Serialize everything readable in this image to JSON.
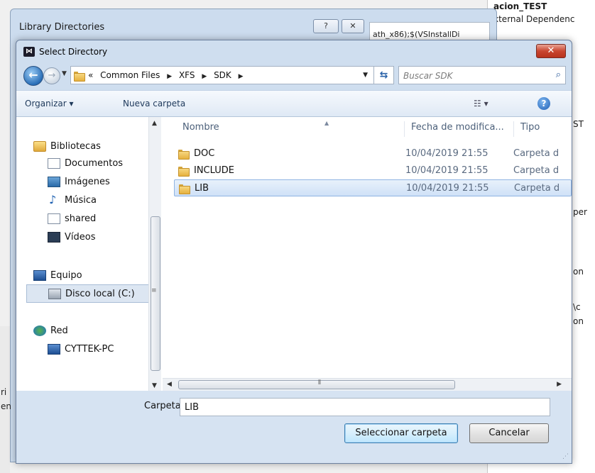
{
  "background": {
    "right_title": "acion_TEST",
    "right_subtitle": "xternal Dependenc",
    "right_fragments": [
      "ST",
      "per",
      "on",
      "\\c",
      "on"
    ],
    "libdir_title": "Library Directories",
    "libdir_help_label": "?",
    "libdir_close_label": "✕",
    "libdir_path_text": "ath_x86);$(VSInstallDi",
    "left_fragments": [
      "ri",
      "en"
    ]
  },
  "dialog": {
    "title": "Select Directory",
    "close_label": "✕"
  },
  "nav": {
    "breadcrumb": [
      "«",
      "Common Files",
      "XFS",
      "SDK"
    ],
    "search_placeholder": "Buscar SDK"
  },
  "toolbar": {
    "organize_label": "Organizar ▾",
    "new_folder_label": "Nueva carpeta",
    "view_label": "☷ ▾",
    "help_label": "?"
  },
  "sidebar": {
    "items": [
      {
        "label": "Bibliotecas",
        "icon": "library-icon"
      },
      {
        "label": "Documentos",
        "icon": "documents-icon"
      },
      {
        "label": "Imágenes",
        "icon": "pictures-icon"
      },
      {
        "label": "Música",
        "icon": "music-icon"
      },
      {
        "label": "shared",
        "icon": "shared-icon"
      },
      {
        "label": "Vídeos",
        "icon": "videos-icon"
      },
      {
        "label": "Equipo",
        "icon": "computer-icon"
      },
      {
        "label": "Disco local (C:)",
        "icon": "local-disk-icon"
      },
      {
        "label": "Red",
        "icon": "network-icon"
      },
      {
        "label": "CYTTEK-PC",
        "icon": "pc-icon"
      }
    ],
    "selected": "Disco local (C:)"
  },
  "file_list": {
    "columns": [
      "Nombre",
      "Fecha de modifica...",
      "Tipo"
    ],
    "rows": [
      {
        "name": "DOC",
        "date": "10/04/2019 21:55",
        "type": "Carpeta d"
      },
      {
        "name": "INCLUDE",
        "date": "10/04/2019 21:55",
        "type": "Carpeta d"
      },
      {
        "name": "LIB",
        "date": "10/04/2019 21:55",
        "type": "Carpeta d"
      }
    ],
    "selected": "LIB"
  },
  "footer": {
    "folder_label": "Carpeta:",
    "folder_value": "LIB",
    "select_button": "Seleccionar carpeta",
    "cancel_button": "Cancelar"
  },
  "colors": {
    "dialog_frame": "#cfdeef",
    "selection": "#cfe1f7",
    "close_red": "#c94630"
  }
}
